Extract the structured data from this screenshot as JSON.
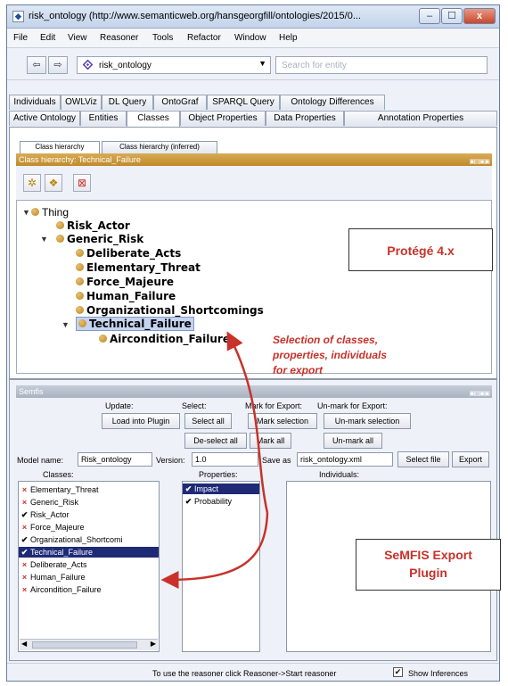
{
  "window": {
    "title": "risk_ontology (http://www.semanticweb.org/hansgeorgfill/ontologies/2015/0...",
    "controls": {
      "minimize": "–",
      "maximize": "☐",
      "close": "x"
    }
  },
  "menu": [
    "File",
    "Edit",
    "View",
    "Reasoner",
    "Tools",
    "Refactor",
    "Window",
    "Help"
  ],
  "toolbar": {
    "back": "⇦",
    "forward": "⇨",
    "ontology": "risk_ontology",
    "search_placeholder": "Search for entity"
  },
  "tabs_row1": [
    "Individuals",
    "OWLViz",
    "DL Query",
    "OntoGraf",
    "SPARQL Query",
    "Ontology Differences"
  ],
  "tabs_row2": [
    "Active Ontology",
    "Entities",
    "Classes",
    "Object Properties",
    "Data Properties",
    "Annotation Properties"
  ],
  "selected_tab": "Classes",
  "class_panel": {
    "subtabs": [
      "Class hierarchy",
      "Class hierarchy (inferred)"
    ],
    "header": "Class hierarchy: Technical_Failure",
    "tree": {
      "root": "Thing",
      "l1": [
        "Risk_Actor",
        "Generic_Risk"
      ],
      "l2": [
        "Deliberate_Acts",
        "Elementary_Threat",
        "Force_Majeure",
        "Human_Failure",
        "Organizational_Shortcomings",
        "Technical_Failure"
      ],
      "l3": [
        "Aircondition_Failure"
      ]
    }
  },
  "callouts": {
    "protege": "Protégé 4.x",
    "selection_note": [
      "Selection of classes,",
      "properties, individuals",
      "for export"
    ],
    "semfis_plugin": [
      "SeMFIS Export",
      "Plugin"
    ]
  },
  "semfis": {
    "header": "Semfis",
    "update_label": "Update:",
    "select_label": "Select:",
    "mark_label": "Mark for Export:",
    "unmark_label": "Un-mark for Export:",
    "load_button": "Load into Plugin",
    "select_all": "Select all",
    "deselect_all": "De-select all",
    "mark_selection": "Mark selection",
    "mark_all": "Mark all",
    "unmark_selection": "Un-mark selection",
    "unmark_all": "Un-mark all",
    "model_name_label": "Model name:",
    "model_name": "Risk_ontology",
    "version_label": "Version:",
    "version": "1.0",
    "save_as_label": "Save as",
    "save_as": "risk_ontology.xml",
    "select_file": "Select file",
    "export": "Export",
    "classes_label": "Classes:",
    "properties_label": "Properties:",
    "individuals_label": "Individuals:",
    "classes": [
      {
        "mark": "×",
        "name": "Elementary_Threat"
      },
      {
        "mark": "×",
        "name": "Generic_Risk"
      },
      {
        "mark": "✔",
        "name": "Risk_Actor"
      },
      {
        "mark": "×",
        "name": "Force_Majeure"
      },
      {
        "mark": "✔",
        "name": "Organizational_Shortcomi"
      },
      {
        "mark": "✔",
        "name": "Technical_Failure"
      },
      {
        "mark": "×",
        "name": "Deliberate_Acts"
      },
      {
        "mark": "×",
        "name": "Human_Failure"
      },
      {
        "mark": "×",
        "name": "Aircondition_Failure"
      }
    ],
    "selected_class": "Technical_Failure",
    "properties": [
      {
        "mark": "✔",
        "name": "Impact"
      },
      {
        "mark": "✔",
        "name": "Probability"
      }
    ]
  },
  "status": {
    "text": "To use the reasoner click Reasoner->Start reasoner",
    "show_inferences": "Show Inferences",
    "show_inferences_checked": "✔"
  },
  "colors": {
    "accent_red": "#c8322a",
    "view_header": "#c8963a",
    "selection": "#1f2a77"
  }
}
